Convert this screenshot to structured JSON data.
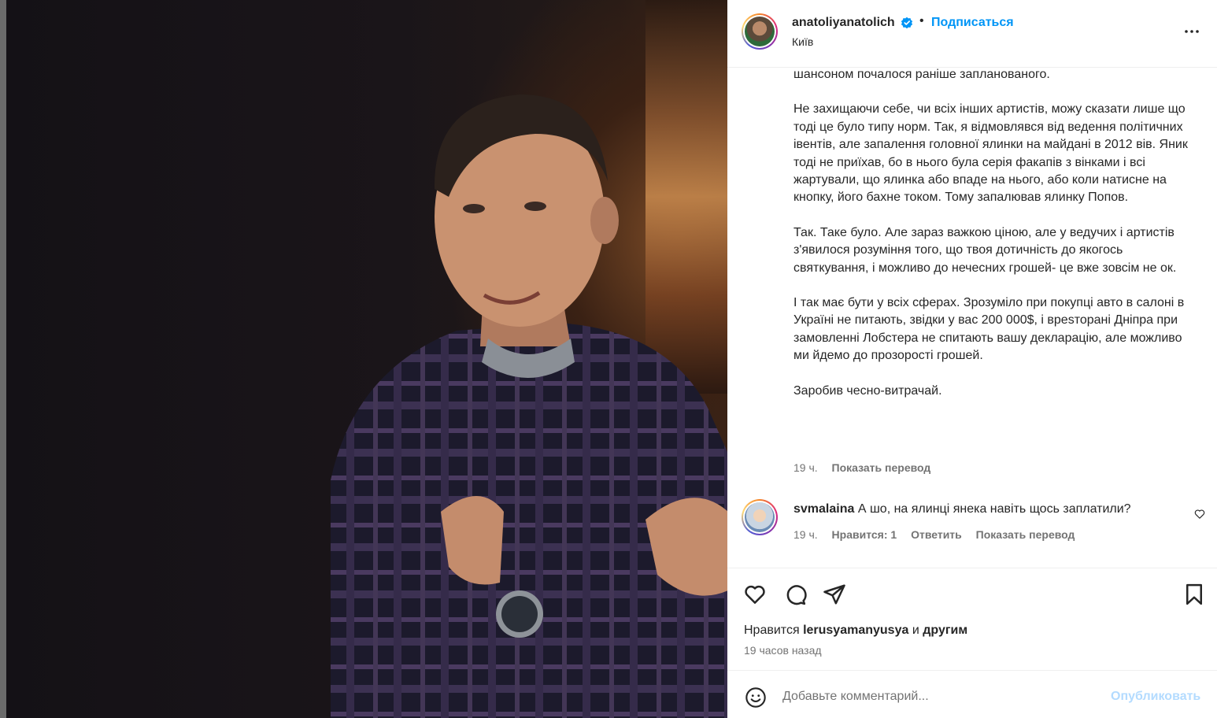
{
  "header": {
    "username": "anatoliyanatolich",
    "follow_label": "Подписаться",
    "location": "Київ"
  },
  "caption": {
    "paragraphs": [
      "шансоном почалося раніше запланованого.",
      "Не захищаючи себе, чи всіх інших артистів, можу сказати лише що тоді це було типу норм. Так, я відмовлявся від ведення політичних івентів, але запалення головної ялинки на майдані в 2012 вів. Яник тоді не приїхав, бо в нього була серія факапів з вінками і всі жартували, що ялинка або впаде на нього, або коли натисне на кнопку, його бахне током. Тому запалював ялинку Попов.",
      "Так. Таке було. Але зараз важкою ціною, але у ведучих і артистів з'явилося розуміння того, що твоя дотичність до якогось святкування, і можливо до нечесних грошей- це вже зовсім не ок.",
      "І так має бути у всіх сферах. Зрозуміло при покупці авто в салоні в Україні не питають, звідки у вас 200 000$, і врesторані Дніпра при замовленні Лобстера не спитають вашу декларацію, але можливо ми йдемо до прозорості грошей.",
      "Заробив чесно-витрачай."
    ],
    "time": "19 ч.",
    "translate_label": "Показать перевод"
  },
  "comment": {
    "username": "svmalaina",
    "text": "А шо, на ялинці янека навіть щось заплатили?",
    "time": "19 ч.",
    "likes": "Нравится: 1",
    "reply": "Ответить",
    "translate": "Показать перевод"
  },
  "actions": {
    "likes_prefix": "Нравится",
    "liker": "lerusyamanyusya",
    "and": "и",
    "others": "другим",
    "ago": "19 часов назад"
  },
  "add_comment": {
    "placeholder": "Добавьте комментарий...",
    "publish": "Опубликовать"
  },
  "colors": {
    "accent": "#0095f6",
    "publish_disabled": "#b3dbff",
    "muted": "#737373"
  }
}
